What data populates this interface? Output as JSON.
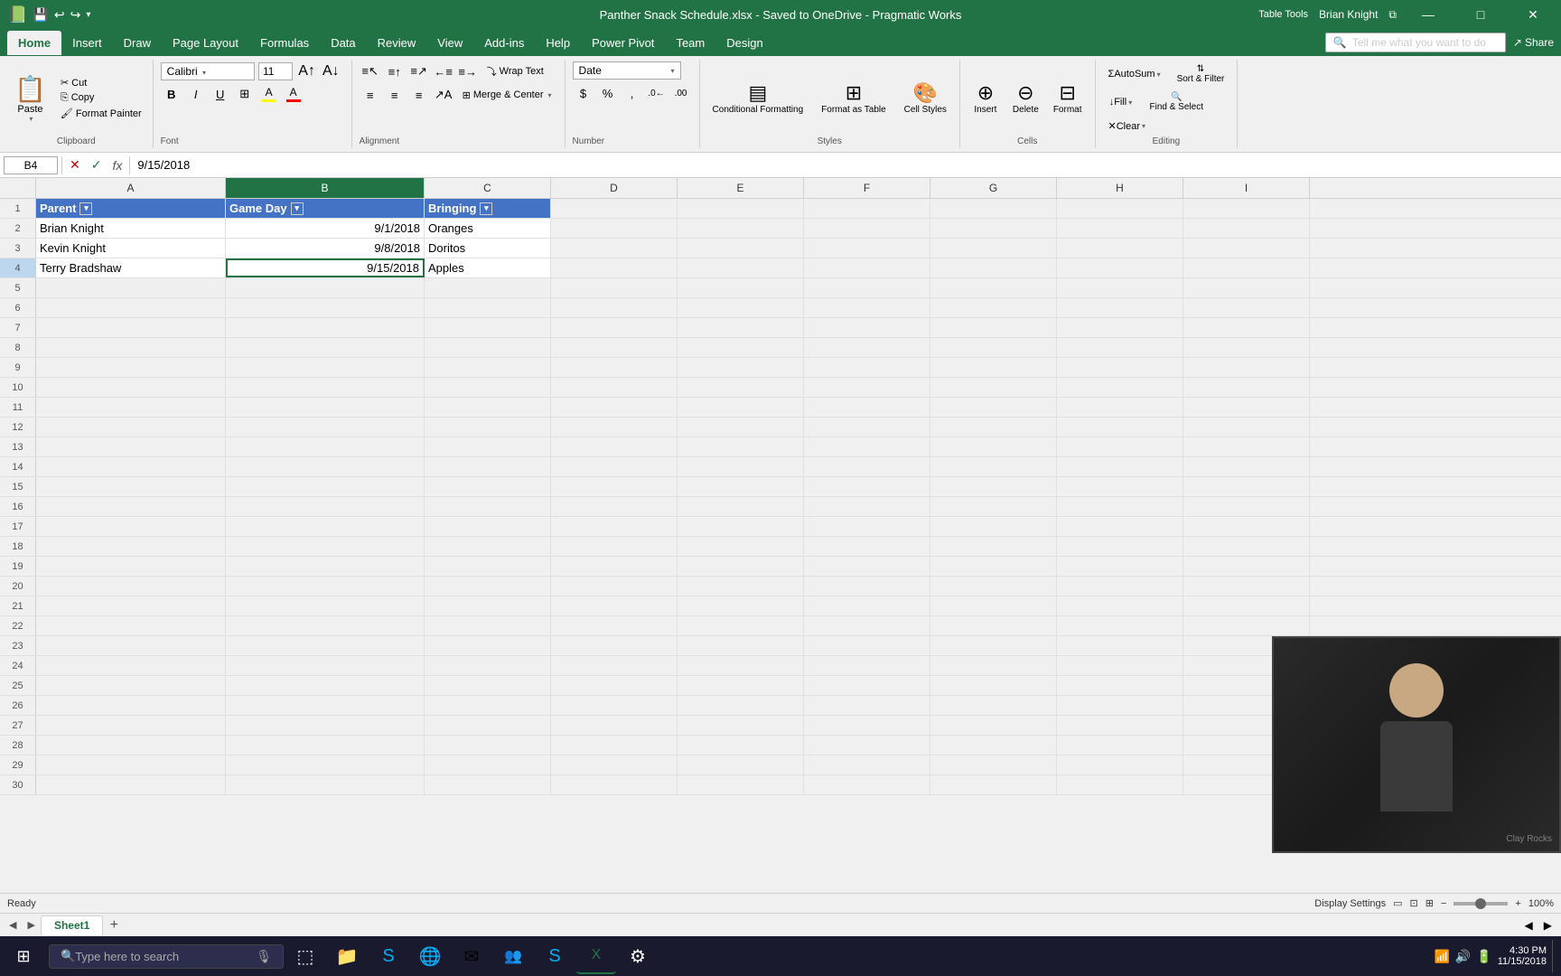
{
  "titlebar": {
    "title": "Panther Snack Schedule.xlsx - Saved to OneDrive - Pragmatic Works",
    "user": "Brian Knight",
    "table_tools": "Table Tools",
    "minimize": "—",
    "maximize": "□",
    "close": "✕"
  },
  "ribbon": {
    "tabs": [
      "Home",
      "Insert",
      "Draw",
      "Page Layout",
      "Formulas",
      "Data",
      "Review",
      "View",
      "Add-ins",
      "Help",
      "Power Pivot",
      "Team",
      "Design"
    ],
    "active_tab": "Home",
    "clipboard": {
      "paste": "Paste",
      "cut": "Cut",
      "copy": "Copy",
      "format_painter": "Format Painter",
      "label": "Clipboard"
    },
    "font": {
      "name": "Calibri",
      "size": "11",
      "grow": "A",
      "shrink": "A",
      "bold": "B",
      "italic": "I",
      "underline": "U",
      "label": "Font"
    },
    "alignment": {
      "wrap_text": "Wrap Text",
      "merge_center": "Merge & Center",
      "label": "Alignment"
    },
    "number": {
      "format": "Date",
      "dollar": "$",
      "percent": "%",
      "comma": ",",
      "label": "Number"
    },
    "styles": {
      "conditional_formatting": "Conditional Formatting",
      "format_as_table": "Format as Table",
      "cell_styles": "Cell Styles",
      "label": "Styles"
    },
    "cells": {
      "insert": "Insert",
      "delete": "Delete",
      "format": "Format",
      "label": "Cells"
    },
    "editing": {
      "autosum": "AutoSum",
      "fill": "Fill",
      "clear": "Clear",
      "sort_filter": "Sort & Filter",
      "find_select": "Find & Select",
      "label": "Editing"
    },
    "search_placeholder": "Tell me what you want to do",
    "share": "Share"
  },
  "formula_bar": {
    "cell_ref": "B4",
    "formula": "9/15/2018",
    "cancel": "✕",
    "confirm": "✓",
    "function": "fx"
  },
  "columns": {
    "headers": [
      "A",
      "B",
      "C",
      "D",
      "E",
      "F",
      "G",
      "H",
      "I"
    ],
    "widths": [
      "col-a",
      "col-b",
      "col-c",
      "col-d",
      "col-e",
      "col-f",
      "col-g",
      "col-h",
      "col-i"
    ]
  },
  "table": {
    "headers": [
      "Parent",
      "Game Day",
      "Bringing"
    ],
    "rows": [
      [
        "Brian Knight",
        "9/1/2018",
        "Oranges"
      ],
      [
        "Kevin Knight",
        "9/8/2018",
        "Doritos"
      ],
      [
        "Terry Bradshaw",
        "9/15/2018",
        "Apples"
      ]
    ]
  },
  "empty_rows": [
    "5",
    "6",
    "7",
    "8",
    "9",
    "10",
    "11",
    "12",
    "13",
    "14",
    "15",
    "16",
    "17",
    "18",
    "19",
    "20",
    "21",
    "22",
    "23",
    "24",
    "25",
    "26",
    "27",
    "28",
    "29",
    "30"
  ],
  "sheet_tabs": [
    "Sheet1"
  ],
  "active_sheet": "Sheet1",
  "status_bar": {
    "ready": "Ready",
    "display_settings": "Display Settings"
  },
  "taskbar": {
    "search_placeholder": "Type here to search",
    "items": [
      "⊞",
      "📁",
      "🎵",
      "🌐",
      "✉",
      "📱",
      "💹",
      "🎯"
    ]
  }
}
